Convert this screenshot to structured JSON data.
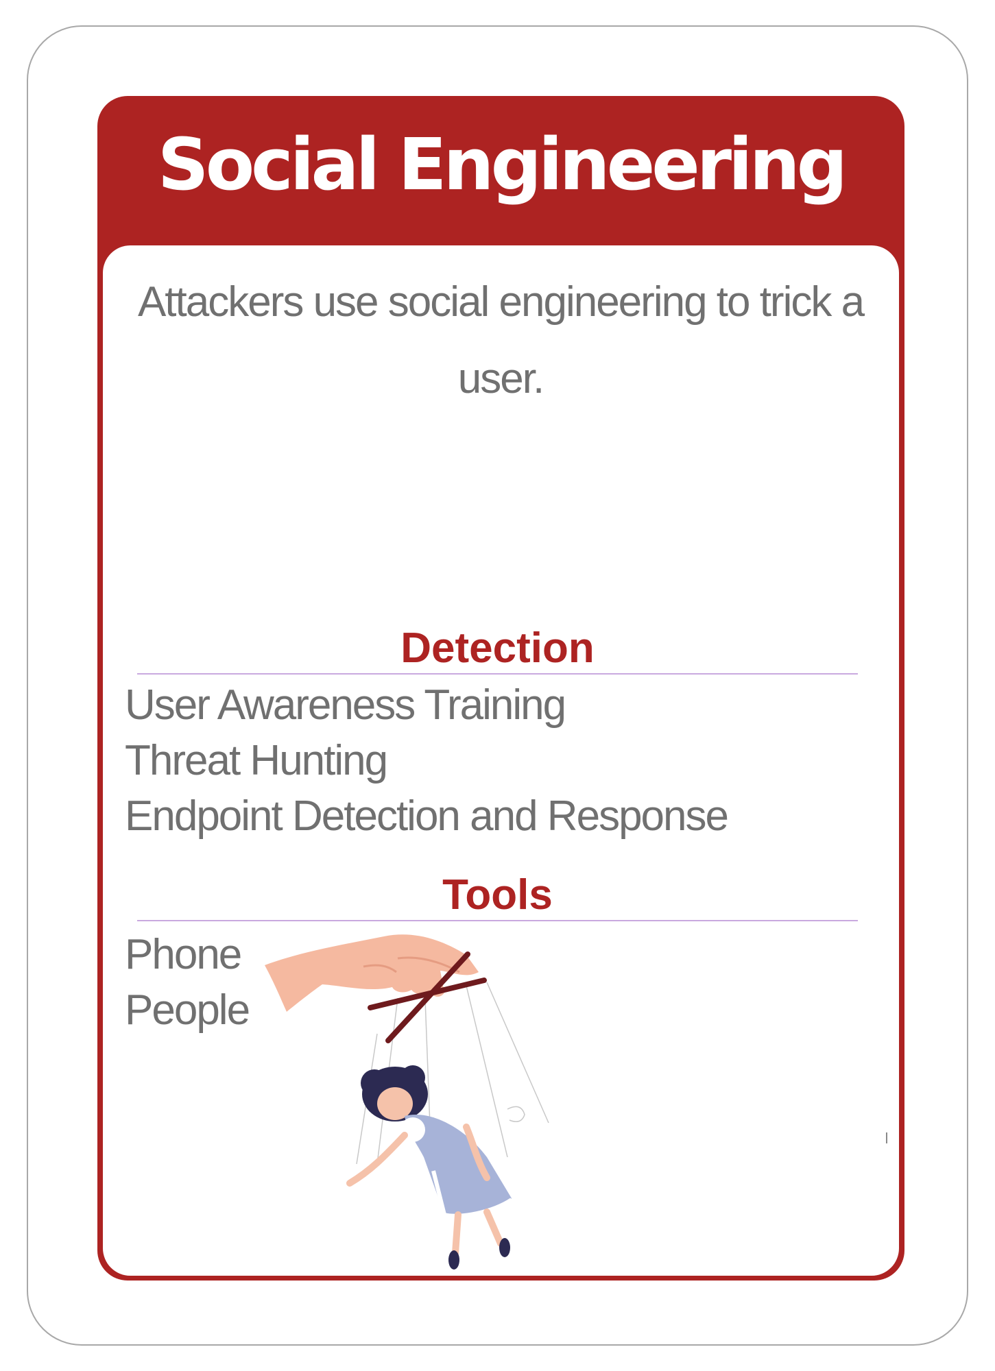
{
  "card": {
    "title": "Social Engineering",
    "description": "Attackers use social engineering to trick a user.",
    "accent_color": "#ad2322",
    "text_color": "#707070",
    "divider_color": "#c9a9df"
  },
  "detection": {
    "heading": "Detection",
    "items": [
      "User Awareness Training",
      "Threat Hunting",
      "Endpoint Detection and Response"
    ]
  },
  "tools": {
    "heading": "Tools",
    "items": [
      "Phone",
      "People"
    ]
  },
  "illustration": {
    "icon": "puppeteer-hand-marionette-icon"
  }
}
